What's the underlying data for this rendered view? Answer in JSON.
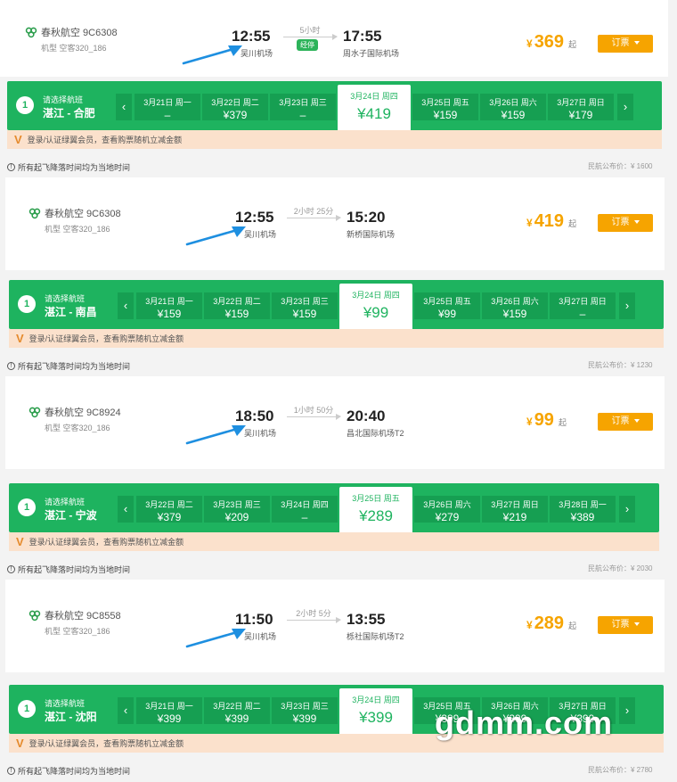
{
  "colors": {
    "green": "#1eb35f",
    "orange": "#f6a400",
    "member_bg": "#fbe1cc"
  },
  "first_card": {
    "airline": "春秋航空 9C6308",
    "plane": "机型 空客320_186",
    "dep_time": "12:55",
    "dep_airport": "吴川机场",
    "duration": "5小时",
    "stop": "经停",
    "arr_time": "17:55",
    "arr_airport": "周水子国际机场",
    "currency": "¥",
    "price": "369",
    "qi": "起",
    "book": "订票"
  },
  "segments": [
    {
      "idx": "1",
      "choose": "请选择航班",
      "route": "湛江 - 合肥",
      "days": [
        {
          "d": "3月21日 周一",
          "p": "–"
        },
        {
          "d": "3月22日 周二",
          "p": "¥379"
        },
        {
          "d": "3月23日 周三",
          "p": "–"
        },
        {
          "d": "3月24日 周四",
          "p": "¥419"
        },
        {
          "d": "3月25日 周五",
          "p": "¥159"
        },
        {
          "d": "3月26日 周六",
          "p": "¥159"
        },
        {
          "d": "3月27日 周日",
          "p": "¥179"
        }
      ],
      "member": "登录/认证绿翼会员，查看购票随机立减金额",
      "note": "所有起飞降落时间均为当地时间",
      "pub": "民航公布价：¥ 1600",
      "flight": {
        "airline": "春秋航空 9C6308",
        "plane": "机型 空客320_186",
        "dep_time": "12:55",
        "dep_airport": "吴川机场",
        "duration": "2小时 25分",
        "arr_time": "15:20",
        "arr_airport": "新桥国际机场",
        "currency": "¥",
        "price": "419",
        "qi": "起",
        "book": "订票"
      }
    },
    {
      "idx": "1",
      "choose": "请选择航班",
      "route": "湛江 - 南昌",
      "days": [
        {
          "d": "3月21日 周一",
          "p": "¥159"
        },
        {
          "d": "3月22日 周二",
          "p": "¥159"
        },
        {
          "d": "3月23日 周三",
          "p": "¥159"
        },
        {
          "d": "3月24日 周四",
          "p": "¥99"
        },
        {
          "d": "3月25日 周五",
          "p": "¥99"
        },
        {
          "d": "3月26日 周六",
          "p": "¥159"
        },
        {
          "d": "3月27日 周日",
          "p": "–"
        }
      ],
      "member": "登录/认证绿翼会员，查看购票随机立减金额",
      "note": "所有起飞降落时间均为当地时间",
      "pub": "民航公布价：¥ 1230",
      "flight": {
        "airline": "春秋航空 9C8924",
        "plane": "机型 空客320_186",
        "dep_time": "18:50",
        "dep_airport": "吴川机场",
        "duration": "1小时 50分",
        "arr_time": "20:40",
        "arr_airport": "昌北国际机场T2",
        "currency": "¥",
        "price": "99",
        "qi": "起",
        "book": "订票"
      }
    },
    {
      "idx": "1",
      "choose": "请选择航班",
      "route": "湛江 - 宁波",
      "days": [
        {
          "d": "3月22日 周二",
          "p": "¥379"
        },
        {
          "d": "3月23日 周三",
          "p": "¥209"
        },
        {
          "d": "3月24日 周四",
          "p": "–"
        },
        {
          "d": "3月25日 周五",
          "p": "¥289"
        },
        {
          "d": "3月26日 周六",
          "p": "¥279"
        },
        {
          "d": "3月27日 周日",
          "p": "¥219"
        },
        {
          "d": "3月28日 周一",
          "p": "¥389"
        }
      ],
      "member": "登录/认证绿翼会员，查看购票随机立减金额",
      "note": "所有起飞降落时间均为当地时间",
      "pub": "民航公布价：¥ 2030",
      "flight": {
        "airline": "春秋航空 9C8558",
        "plane": "机型 空客320_186",
        "dep_time": "11:50",
        "dep_airport": "吴川机场",
        "duration": "2小时 5分",
        "arr_time": "13:55",
        "arr_airport": "栎社国际机场T2",
        "currency": "¥",
        "price": "289",
        "qi": "起",
        "book": "订票"
      }
    },
    {
      "idx": "1",
      "choose": "请选择航班",
      "route": "湛江 - 沈阳",
      "days": [
        {
          "d": "3月21日 周一",
          "p": "¥399"
        },
        {
          "d": "3月22日 周二",
          "p": "¥399"
        },
        {
          "d": "3月23日 周三",
          "p": "¥399"
        },
        {
          "d": "3月24日 周四",
          "p": "¥399"
        },
        {
          "d": "3月25日 周五",
          "p": "¥399"
        },
        {
          "d": "3月26日 周六",
          "p": "¥399"
        },
        {
          "d": "3月27日 周日",
          "p": "¥399"
        }
      ],
      "member": "登录/认证绿翼会员，查看购票随机立减金额",
      "note": "所有起飞降落时间均为当地时间",
      "pub": "民航公布价：¥ 2780"
    }
  ],
  "watermark": "gdmm.com"
}
